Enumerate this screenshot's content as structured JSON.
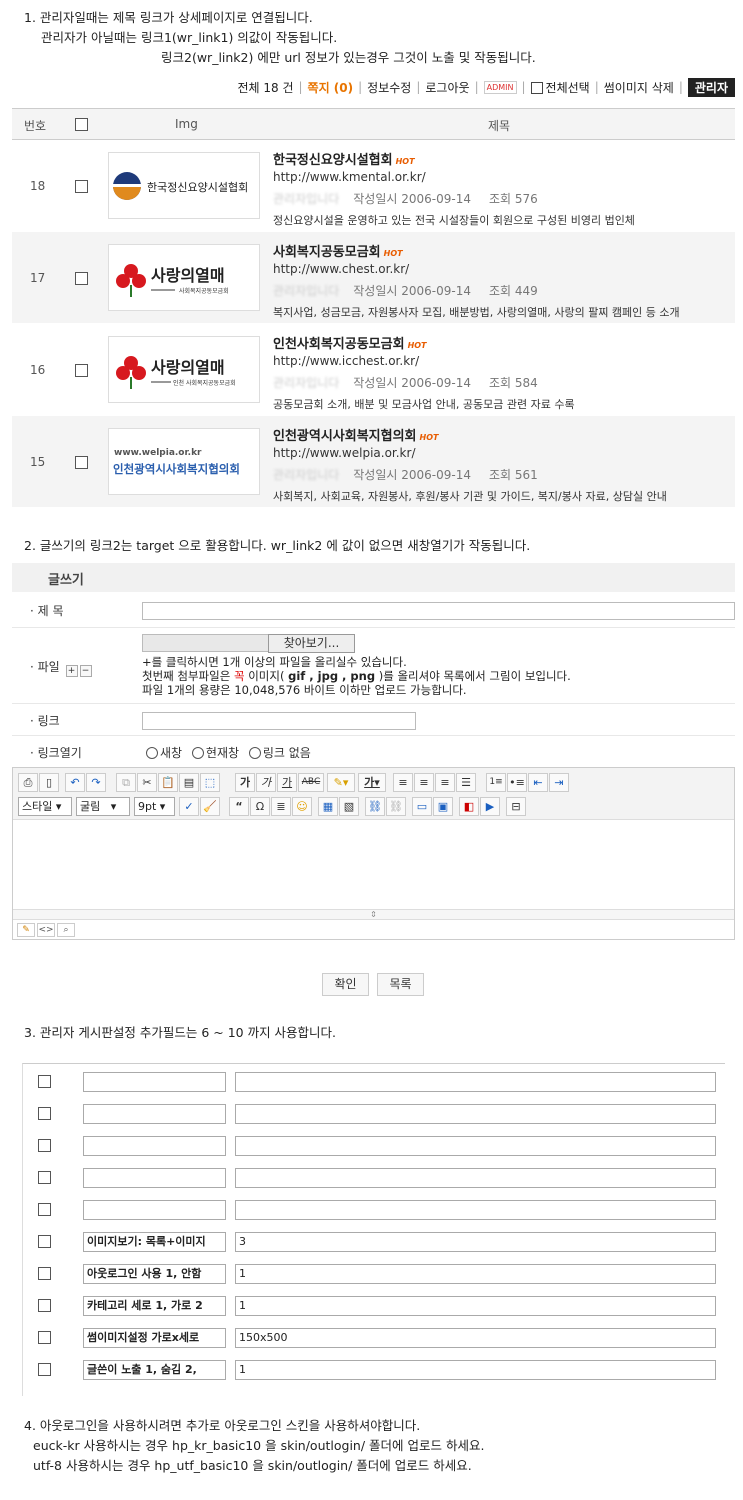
{
  "notes": {
    "n1": "1. 관리자일때는 제목 링크가 상세페이지로 연결됩니다.",
    "n1b": "관리자가 아닐때는 링크1(wr_link1) 의값이 작동됩니다.",
    "n1c": "링크2(wr_link2) 에만 url 정보가 있는경우 그것이 노출 및 작동됩니다.",
    "n2": "2. 글쓰기의 링크2는 target 으로 활용합니다.  wr_link2 에 값이 없으면 새창열기가 작동됩니다.",
    "n3": "3. 관리자 게시판설정 추가필드는  6 ~ 10 까지 사용합니다.",
    "n4": "4. 아웃로그인을 사용하시려면 추가로 아웃로그인 스킨을 사용하셔야합니다.",
    "n4b": "euck-kr 사용하시는 경우 hp_kr_basic10  을  skin/outlogin/ 폴더에 업로드 하세요.",
    "n4c": "utf-8     사용하시는 경우  hp_utf_basic10 을  skin/outlogin/ 폴더에 업로드 하세요."
  },
  "infobar": {
    "total": "전체 18 건",
    "memo": "쪽지 (0)",
    "edit": "정보수정",
    "logout": "로그아웃",
    "admin_tag": "ADMIN",
    "select_all": "전체선택",
    "del_thumb": "썸이미지 삭제",
    "admin_btn": "관리자"
  },
  "list": {
    "headers": {
      "num": "번호",
      "img": "Img",
      "subject": "제목"
    },
    "hot": "HOT",
    "rows": [
      {
        "num": "18",
        "logo": "한국정신요양시설협회",
        "title": "한국정신요양시설협회",
        "url": "http://www.kmental.or.kr/",
        "author": "관리자입니다",
        "date": "작성일시 2006-09-14",
        "hits": "조회 576",
        "desc": "정신요양시설을 운영하고 있는 전국 시설장들이 회원으로 구성된 비영리 법인체"
      },
      {
        "num": "17",
        "logo": "사랑의열매",
        "logo_sub": "사회복지공동모금회",
        "title": "사회복지공동모금회",
        "url": "http://www.chest.or.kr/",
        "author": "관리자입니다",
        "date": "작성일시 2006-09-14",
        "hits": "조회 449",
        "desc": "복지사업, 성금모금, 자원봉사자 모집, 배분방법, 사랑의열매, 사랑의 팔찌 캠페인 등 소개"
      },
      {
        "num": "16",
        "logo": "사랑의열매",
        "logo_sub": "인천 사회복지공동모금회",
        "title": "인천사회복지공동모금회",
        "url": "http://www.icchest.or.kr/",
        "author": "관리자입니다",
        "date": "작성일시 2006-09-14",
        "hits": "조회 584",
        "desc": "공동모금회 소개, 배분 및 모금사업 안내, 공동모금 관련 자료 수록"
      },
      {
        "num": "15",
        "logo": "인천광역시사회복지협의회",
        "logo_sub": "www.welpia.or.kr",
        "title": "인천광역시사회복지협의회",
        "url": "http://www.welpia.or.kr/",
        "author": "관리자입니다",
        "date": "작성일시 2006-09-14",
        "hits": "조회 561",
        "desc": "사회복지, 사회교육, 자원봉사, 후원/봉사 기관 및 가이드, 복지/봉사 자료, 상담실 안내"
      }
    ]
  },
  "write": {
    "title": "글쓰기",
    "subject_label": "· 제 목",
    "file_label": "· 파일",
    "browse": "찾아보기...",
    "file_help1": "+를 클릭하시면 1개 이상의 파일을 올리실수 있습니다.",
    "file_help2a": "첫번째 첨부파일은 ",
    "file_help2b": "꼭",
    "file_help2c": " 이미지( ",
    "file_help2d": "gif , jpg , png",
    "file_help2e": " )를 올리셔야 목록에서 그림이 보입니다.",
    "file_help3": "파일 1개의 용량은 10,048,576 바이트 이하만 업로드 가능합니다.",
    "link_label": "· 링크",
    "linkopen_label": "· 링크열기",
    "opt_new": "새창",
    "opt_cur": "현재창",
    "opt_none": "링크 없음",
    "style": "스타일",
    "font": "굴림",
    "size": "9pt",
    "ok": "확인",
    "list": "목록"
  },
  "fields": [
    {
      "a": "",
      "b": ""
    },
    {
      "a": "",
      "b": ""
    },
    {
      "a": "",
      "b": ""
    },
    {
      "a": "",
      "b": ""
    },
    {
      "a": "",
      "b": ""
    },
    {
      "a": "이미지보기: 목록+이미지",
      "b": "3"
    },
    {
      "a": "아웃로그인 사용 1, 안함",
      "b": "1"
    },
    {
      "a": "카테고리 세로 1, 가로 2",
      "b": "1"
    },
    {
      "a": "썸이미지설정 가로x세로",
      "b": "150x500"
    },
    {
      "a": "글쓴이 노출 1, 숨김 2,",
      "b": "1"
    }
  ]
}
